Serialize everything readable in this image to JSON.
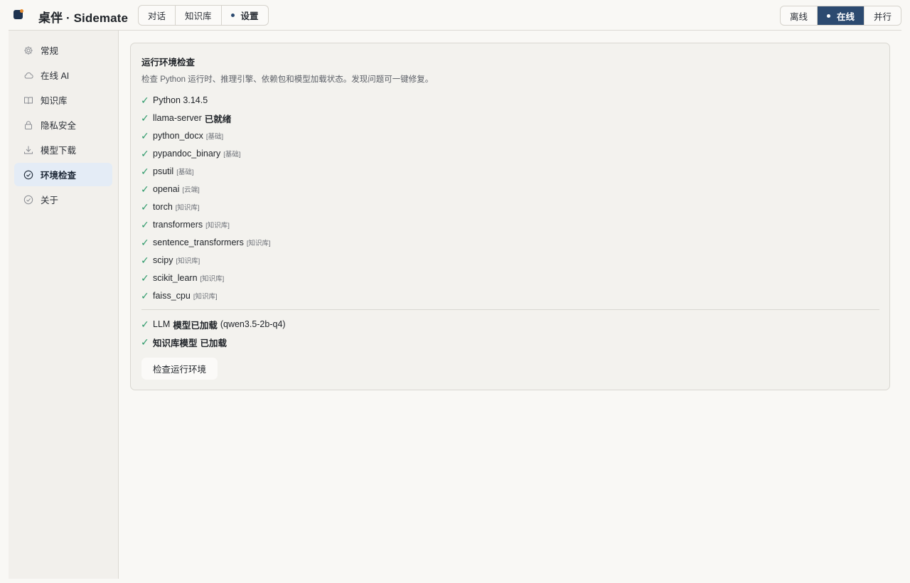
{
  "app": {
    "title": "桌伴 · Sidemate",
    "colors": {
      "brand": "#1e3350",
      "accent": "#2c4a70",
      "success": "#2e9a6a",
      "active_sidebar_bg": "#e4ecf6"
    }
  },
  "nav": {
    "tabs": [
      {
        "label": "对话",
        "active": false
      },
      {
        "label": "知识库",
        "active": false
      },
      {
        "label": "设置",
        "active": true
      }
    ]
  },
  "mode": {
    "options": [
      {
        "label": "离线",
        "active": false
      },
      {
        "label": "在线",
        "active": true
      },
      {
        "label": "并行",
        "active": false
      }
    ]
  },
  "sidebar": {
    "items": [
      {
        "label": "常规",
        "icon": "gear-icon",
        "active": false
      },
      {
        "label": "在线 AI",
        "icon": "cloud-icon",
        "active": false
      },
      {
        "label": "知识库",
        "icon": "book-icon",
        "active": false
      },
      {
        "label": "隐私安全",
        "icon": "lock-icon",
        "active": false
      },
      {
        "label": "模型下载",
        "icon": "download-icon",
        "active": false
      },
      {
        "label": "环境检查",
        "icon": "check-circle-icon",
        "active": true
      },
      {
        "label": "关于",
        "icon": "info-circle-icon",
        "active": false
      }
    ]
  },
  "panel": {
    "title": "运行环境检查",
    "description": "检查 Python 运行时、推理引擎、依赖包和模型加载状态。发现问题可一键修复。",
    "checks": [
      {
        "status": "ok",
        "name": "Python 3.14.5",
        "suffix": "",
        "tag": ""
      },
      {
        "status": "ok",
        "name": "llama-server",
        "suffix": "已就绪",
        "tag": ""
      },
      {
        "status": "ok",
        "name": "python_docx",
        "suffix": "",
        "tag": "[基础]"
      },
      {
        "status": "ok",
        "name": "pypandoc_binary",
        "suffix": "",
        "tag": "[基础]"
      },
      {
        "status": "ok",
        "name": "psutil",
        "suffix": "",
        "tag": "[基础]"
      },
      {
        "status": "ok",
        "name": "openai",
        "suffix": "",
        "tag": "[云端]"
      },
      {
        "status": "ok",
        "name": "torch",
        "suffix": "",
        "tag": "[知识库]"
      },
      {
        "status": "ok",
        "name": "transformers",
        "suffix": "",
        "tag": "[知识库]"
      },
      {
        "status": "ok",
        "name": "sentence_transformers",
        "suffix": "",
        "tag": "[知识库]"
      },
      {
        "status": "ok",
        "name": "scipy",
        "suffix": "",
        "tag": "[知识库]"
      },
      {
        "status": "ok",
        "name": "scikit_learn",
        "suffix": "",
        "tag": "[知识库]"
      },
      {
        "status": "ok",
        "name": "faiss_cpu",
        "suffix": "",
        "tag": "[知识库]"
      }
    ],
    "models": {
      "llm": {
        "prefix": "LLM",
        "status": "模型已加载",
        "detail": "(qwen3.5-2b-q4)"
      },
      "kb": {
        "label": "知识库模型",
        "status": "已加载"
      }
    },
    "action_label": "检查运行环境"
  }
}
